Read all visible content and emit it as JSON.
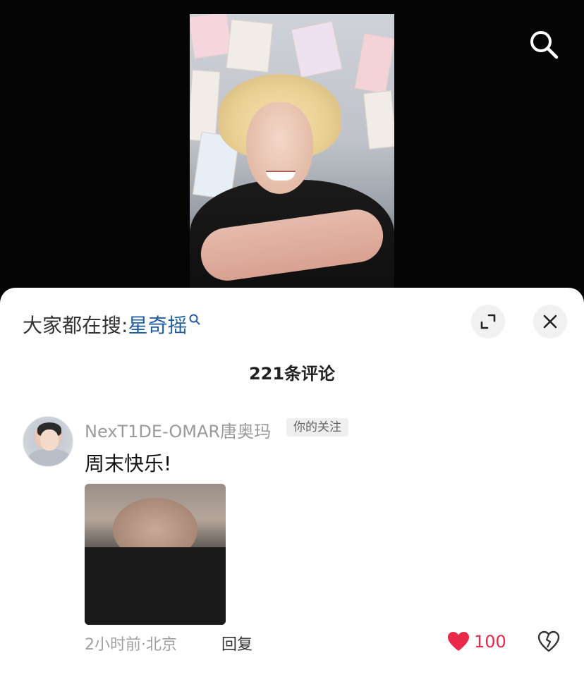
{
  "top": {
    "search_icon": "search-icon"
  },
  "sheet": {
    "trending": {
      "prefix": "大家都在搜:",
      "term": "星奇摇",
      "term_icon": "search-small-icon"
    },
    "buttons": {
      "expand_icon": "expand-icon",
      "close_icon": "close-icon"
    },
    "comment_count": "221条评论",
    "comments": [
      {
        "username": "NexT1DE-OMAR唐奥玛",
        "badge": "你的关注",
        "text": "周末快乐!",
        "meta": "2小时前·北京",
        "reply_label": "回复",
        "likes": "100"
      }
    ]
  },
  "colors": {
    "accent_link": "#1f5e9e",
    "like_red": "#e8294a",
    "secondary_text": "#a0a0a0"
  }
}
